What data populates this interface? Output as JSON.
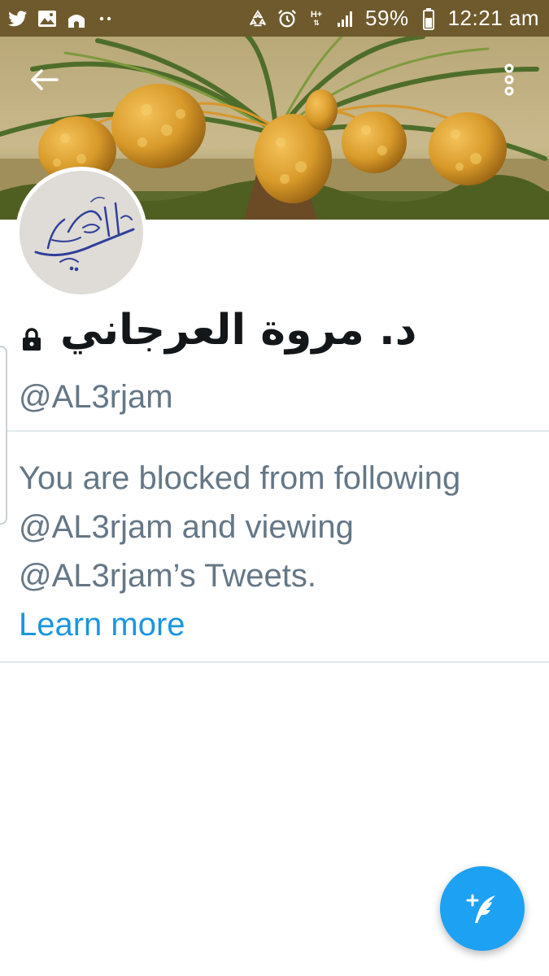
{
  "status_bar": {
    "battery_percent": "59%",
    "time": "12:21 am",
    "network": "H+",
    "icons_left": [
      "twitter-icon",
      "gallery-icon",
      "mosque-icon",
      "more-notifications-icon"
    ],
    "icons_right": [
      "recycle-icon",
      "alarm-icon",
      "network-type-icon",
      "signal-icon",
      "battery-icon"
    ],
    "background_color": "#6e5a2c"
  },
  "header": {
    "back_icon": "arrow-left-icon",
    "menu_icon": "overflow-menu-icon"
  },
  "profile": {
    "display_name": "د. مروة العرجاني",
    "handle": "@AL3rjam",
    "protected_icon": "lock-icon",
    "blocked_message": "You are blocked from following @AL3rjam and viewing @AL3rjam’s Tweets.",
    "learn_more_label": "Learn more"
  },
  "fab": {
    "icon": "compose-tweet-icon"
  },
  "colors": {
    "accent": "#1da1f2",
    "link": "#1b95e0",
    "secondary_text": "#657786",
    "primary_text": "#14171a"
  }
}
